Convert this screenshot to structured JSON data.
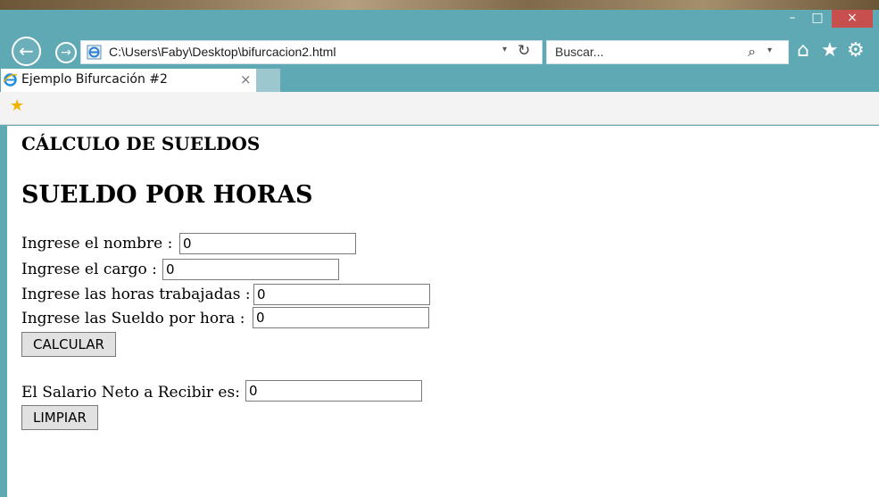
{
  "window": {
    "controls": {
      "minimize": "–",
      "maximize": "□",
      "close": "×"
    }
  },
  "navigation": {
    "back_icon": "←",
    "forward_icon": "→",
    "address": "C:\\Users\\Faby\\Desktop\\bifurcacion2.html",
    "address_dropdown": "▾",
    "refresh_icon": "↻",
    "search_placeholder": "Buscar...",
    "search_icon": "⌕",
    "search_dropdown": "▾",
    "home_icon": "⌂",
    "favorites_icon": "★",
    "settings_icon": "⚙"
  },
  "tab": {
    "title": "Ejemplo Bifurcación #2",
    "close": "×"
  },
  "favorites_bar": {
    "icon": "★"
  },
  "page": {
    "heading1": "CÁLCULO DE SUELDOS",
    "heading2": "SUELDO POR HORAS",
    "fields": [
      {
        "label": "Ingrese el nombre :",
        "value": "0"
      },
      {
        "label": "Ingrese el cargo :",
        "value": "0"
      },
      {
        "label": "Ingrese las horas trabajadas :",
        "value": "0"
      },
      {
        "label": "Ingrese las Sueldo por hora :",
        "value": "0"
      }
    ],
    "calculate_button": "CALCULAR",
    "result_label": "El Salario Neto a Recibir es:",
    "result_value": "0",
    "clear_button": "LIMPIAR"
  },
  "colors": {
    "chrome": "#5ea9b4",
    "close_button": "#c7504f",
    "favorites_bar": "#f3f3f3"
  }
}
